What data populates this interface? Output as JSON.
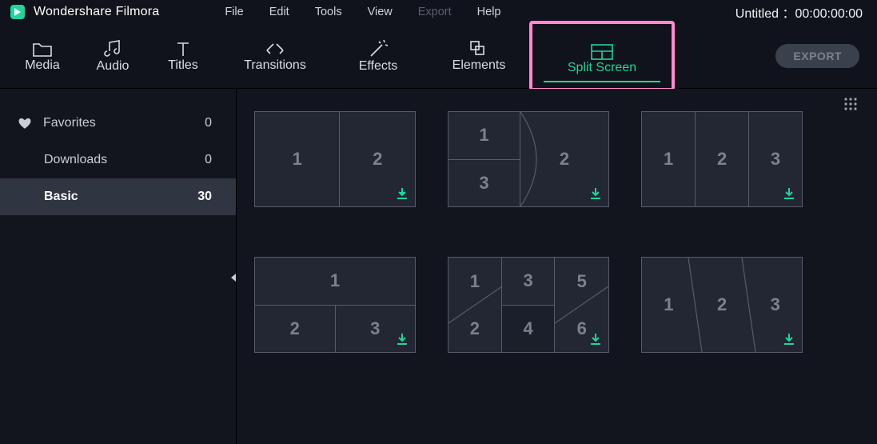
{
  "app_name": "Wondershare Filmora",
  "menu": {
    "file": "File",
    "edit": "Edit",
    "tools": "Tools",
    "view": "View",
    "export": "Export",
    "help": "Help"
  },
  "doc_title": "Untitled ：00:00:00:00",
  "tabs": {
    "media": "Media",
    "audio": "Audio",
    "titles": "Titles",
    "transitions": "Transitions",
    "effects": "Effects",
    "elements": "Elements",
    "split": "Split Screen"
  },
  "export_button": "EXPORT",
  "sidebar": {
    "favorites": {
      "label": "Favorites",
      "count": "0"
    },
    "downloads": {
      "label": "Downloads",
      "count": "0"
    },
    "basic": {
      "label": "Basic",
      "count": "30"
    }
  },
  "templates": {
    "1": [
      "1",
      "2"
    ],
    "2": [
      "1",
      "2",
      "3"
    ],
    "3": [
      "1",
      "2",
      "3"
    ],
    "4": [
      "1",
      "2",
      "3"
    ],
    "5": [
      "1",
      "2",
      "3",
      "4",
      "5",
      "6"
    ],
    "6": [
      "1",
      "2",
      "3"
    ]
  },
  "colors": {
    "accent": "#23d39b",
    "highlight_frame": "#ff8bcf"
  }
}
